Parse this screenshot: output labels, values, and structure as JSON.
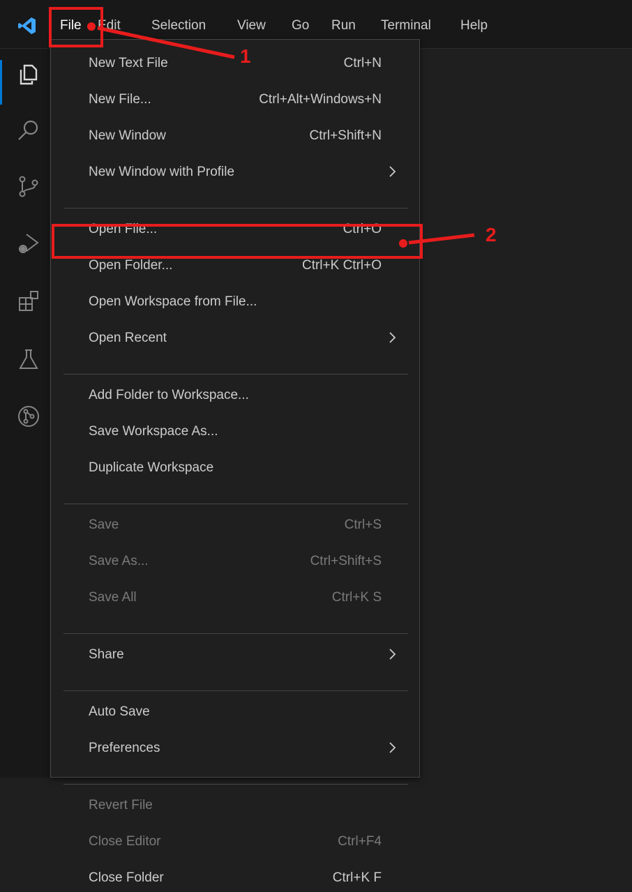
{
  "menubar": {
    "items": [
      "File",
      "Edit",
      "Selection",
      "View",
      "Go",
      "Run",
      "Terminal",
      "Help"
    ]
  },
  "activity_icons": [
    "explorer-icon",
    "search-icon",
    "source-control-icon",
    "run-debug-icon",
    "extensions-icon",
    "testing-icon",
    "git-graph-icon"
  ],
  "file_menu": {
    "groups": [
      [
        {
          "label": "New Text File",
          "shortcut": "Ctrl+N",
          "submenu": false,
          "enabled": true
        },
        {
          "label": "New File...",
          "shortcut": "Ctrl+Alt+Windows+N",
          "submenu": false,
          "enabled": true
        },
        {
          "label": "New Window",
          "shortcut": "Ctrl+Shift+N",
          "submenu": false,
          "enabled": true
        },
        {
          "label": "New Window with Profile",
          "shortcut": "",
          "submenu": true,
          "enabled": true
        }
      ],
      [
        {
          "label": "Open File...",
          "shortcut": "Ctrl+O",
          "submenu": false,
          "enabled": true
        },
        {
          "label": "Open Folder...",
          "shortcut": "Ctrl+K Ctrl+O",
          "submenu": false,
          "enabled": true
        },
        {
          "label": "Open Workspace from File...",
          "shortcut": "",
          "submenu": false,
          "enabled": true
        },
        {
          "label": "Open Recent",
          "shortcut": "",
          "submenu": true,
          "enabled": true
        }
      ],
      [
        {
          "label": "Add Folder to Workspace...",
          "shortcut": "",
          "submenu": false,
          "enabled": true
        },
        {
          "label": "Save Workspace As...",
          "shortcut": "",
          "submenu": false,
          "enabled": true
        },
        {
          "label": "Duplicate Workspace",
          "shortcut": "",
          "submenu": false,
          "enabled": true
        }
      ],
      [
        {
          "label": "Save",
          "shortcut": "Ctrl+S",
          "submenu": false,
          "enabled": false
        },
        {
          "label": "Save As...",
          "shortcut": "Ctrl+Shift+S",
          "submenu": false,
          "enabled": false
        },
        {
          "label": "Save All",
          "shortcut": "Ctrl+K S",
          "submenu": false,
          "enabled": false
        }
      ],
      [
        {
          "label": "Share",
          "shortcut": "",
          "submenu": true,
          "enabled": true
        }
      ],
      [
        {
          "label": "Auto Save",
          "shortcut": "",
          "submenu": false,
          "enabled": true
        },
        {
          "label": "Preferences",
          "shortcut": "",
          "submenu": true,
          "enabled": true
        }
      ],
      [
        {
          "label": "Revert File",
          "shortcut": "",
          "submenu": false,
          "enabled": false
        },
        {
          "label": "Close Editor",
          "shortcut": "Ctrl+F4",
          "submenu": false,
          "enabled": false
        },
        {
          "label": "Close Folder",
          "shortcut": "Ctrl+K F",
          "submenu": false,
          "enabled": true
        }
      ]
    ]
  },
  "annotations": {
    "step1": "1",
    "step2": "2",
    "color": "#e81c1c"
  },
  "colors": {
    "accent": "#0078d4",
    "logo": "#3ea6ff"
  }
}
